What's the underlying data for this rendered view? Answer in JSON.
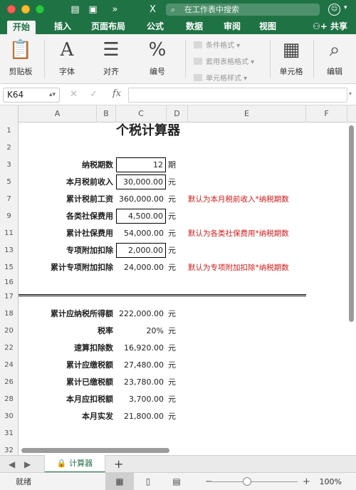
{
  "titlebar": {
    "search_placeholder": "在工作表中搜索",
    "colors": {
      "brand": "#1f7244"
    }
  },
  "tabs": [
    {
      "label": "开始",
      "active": true
    },
    {
      "label": "插入"
    },
    {
      "label": "页面布局"
    },
    {
      "label": "公式"
    },
    {
      "label": "数据"
    },
    {
      "label": "审阅"
    },
    {
      "label": "视图"
    }
  ],
  "share_label": "共享",
  "ribbon": {
    "clipboard": {
      "label": "剪贴板",
      "icon": "clipboard-icon"
    },
    "font": {
      "label": "字体",
      "icon": "font-icon"
    },
    "align": {
      "label": "对齐",
      "icon": "align-icon"
    },
    "number": {
      "label": "编号",
      "icon": "percent-icon"
    },
    "cond_format": "条件格式",
    "table_format": "套用表格格式",
    "cell_style": "单元格样式",
    "cells": {
      "label": "单元格",
      "icon": "cells-icon"
    },
    "edit": {
      "label": "编辑",
      "icon": "search-icon"
    }
  },
  "formula_bar": {
    "name_box": "K64",
    "fx": "fx",
    "value": ""
  },
  "columns": [
    "A",
    "B",
    "C",
    "D",
    "E",
    "F"
  ],
  "rows": [
    {
      "num": "1",
      "title": "个税计算器"
    },
    {
      "num": "2"
    },
    {
      "num": "3",
      "label": "纳税期数",
      "value": "12",
      "unit": "期",
      "boxed": true
    },
    {
      "num": "5",
      "label": "本月税前收入",
      "value": "30,000.00",
      "unit": "元",
      "boxed": true
    },
    {
      "num": "7",
      "label": "累计税前工资",
      "value": "360,000.00",
      "unit": "元",
      "note": "默认为本月税前收入*纳税期数"
    },
    {
      "num": "9",
      "label": "各类社保费用",
      "value": "4,500.00",
      "unit": "元",
      "boxed": true
    },
    {
      "num": "11",
      "label": "累计社保费用",
      "value": "54,000.00",
      "unit": "元",
      "note": "默认为各类社保费用*纳税期数"
    },
    {
      "num": "13",
      "label": "专项附加扣除",
      "value": "2,000.00",
      "unit": "元",
      "boxed": true
    },
    {
      "num": "15",
      "label": "累计专项附加扣除",
      "value": "24,000.00",
      "unit": "元",
      "note": "默认为专项附加扣除*纳税期数"
    },
    {
      "num": "16"
    },
    {
      "num": "17"
    },
    {
      "num": "18",
      "label": "累计应纳税所得额",
      "value": "222,000.00",
      "unit": "元"
    },
    {
      "num": "20",
      "label": "税率",
      "value": "20%",
      "unit": "元"
    },
    {
      "num": "22",
      "label": "速算扣除数",
      "value": "16,920.00",
      "unit": "元"
    },
    {
      "num": "24",
      "label": "累计应缴税额",
      "value": "27,480.00",
      "unit": "元"
    },
    {
      "num": "26",
      "label": "累计已缴税额",
      "value": "23,780.00",
      "unit": "元"
    },
    {
      "num": "28",
      "label": "本月应扣税额",
      "value": "3,700.00",
      "unit": "元"
    },
    {
      "num": "30",
      "label": "本月实发",
      "value": "21,800.00",
      "unit": "元"
    },
    {
      "num": "31"
    },
    {
      "num": "32"
    }
  ],
  "sheet_tab": "计算器",
  "status": {
    "ready": "就绪",
    "zoom": "100%"
  }
}
